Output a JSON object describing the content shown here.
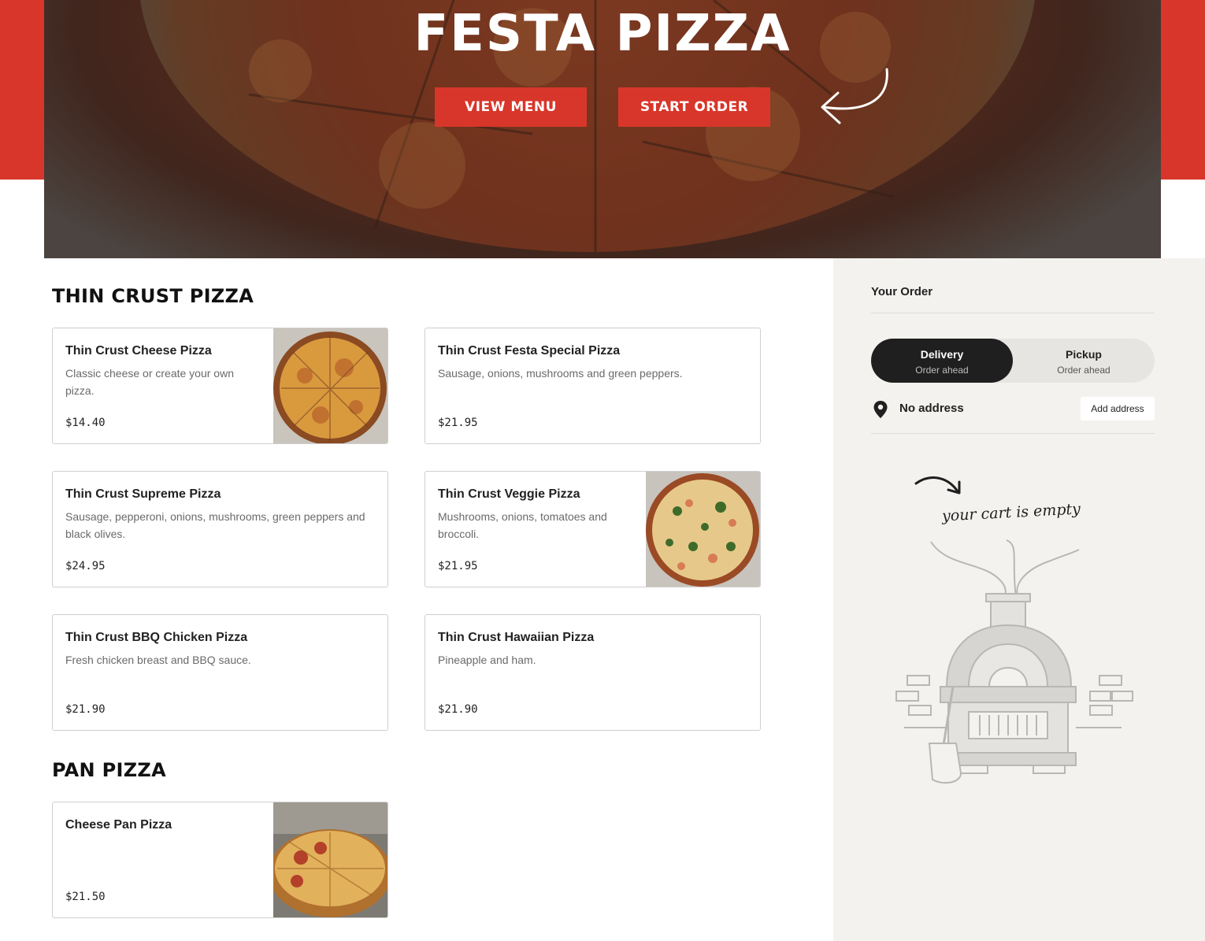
{
  "hero": {
    "title": "FESTA PIZZA",
    "view_menu_label": "VIEW MENU",
    "start_order_label": "START ORDER"
  },
  "sections": [
    {
      "title": "THIN CRUST PIZZA",
      "items": [
        {
          "name": "Thin Crust Cheese Pizza",
          "desc": "Classic cheese or create your own pizza.",
          "price": "$14.40",
          "image": "cheese-pizza-photo"
        },
        {
          "name": "Thin Crust Festa Special Pizza",
          "desc": "Sausage, onions, mushrooms and green peppers.",
          "price": "$21.95"
        },
        {
          "name": "Thin Crust Supreme Pizza",
          "desc": "Sausage, pepperoni, onions, mushrooms, green peppers and black olives.",
          "price": "$24.95"
        },
        {
          "name": "Thin Crust Veggie Pizza",
          "desc": "Mushrooms, onions, tomatoes and broccoli.",
          "price": "$21.95",
          "image": "veggie-pizza-photo"
        },
        {
          "name": "Thin Crust BBQ Chicken Pizza",
          "desc": "Fresh chicken breast and BBQ sauce.",
          "price": "$21.90"
        },
        {
          "name": "Thin Crust Hawaiian Pizza",
          "desc": "Pineapple and ham.",
          "price": "$21.90"
        }
      ]
    },
    {
      "title": "PAN PIZZA",
      "items": [
        {
          "name": "Cheese Pan Pizza",
          "desc": "",
          "price": "$21.50",
          "image": "pan-pizza-photo"
        }
      ]
    }
  ],
  "order": {
    "title": "Your Order",
    "delivery_label": "Delivery",
    "delivery_sub": "Order ahead",
    "pickup_label": "Pickup",
    "pickup_sub": "Order ahead",
    "selected_mode": "Delivery",
    "address_text": "No address",
    "add_address_label": "Add address",
    "empty_text": "your cart is empty"
  },
  "colors": {
    "brand_red": "#d8362a",
    "sidebar_bg": "#f3f2ef",
    "toggle_active": "#1f1f1f"
  },
  "icons": [
    "arrow-doodle-icon",
    "location-pin-icon",
    "pizza-oven-illustration"
  ]
}
